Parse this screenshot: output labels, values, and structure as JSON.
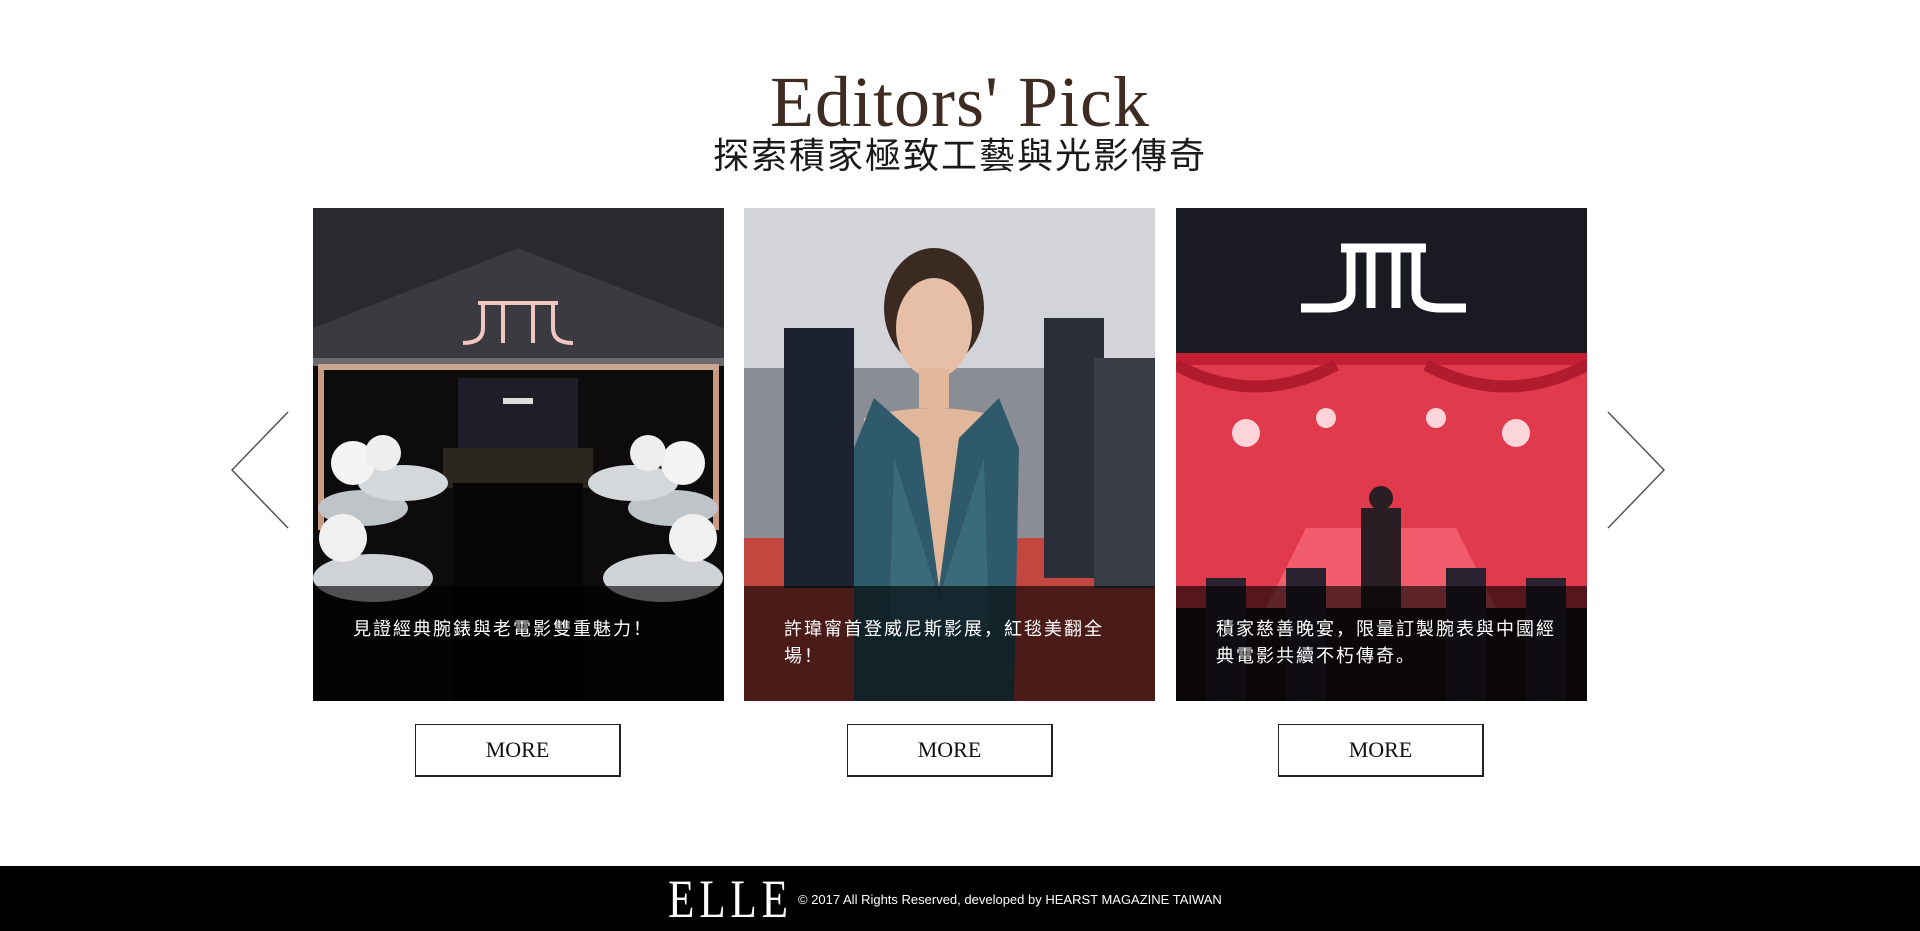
{
  "header": {
    "title": "Editors' Pick",
    "subtitle": "探索積家極致工藝與光影傳奇"
  },
  "carousel": {
    "prev_icon": "chevron-left-icon",
    "next_icon": "chevron-right-icon",
    "cards": [
      {
        "caption": "見證經典腕錶與老電影雙重魅力！",
        "more_label": "MORE"
      },
      {
        "caption": "許瑋甯首登威尼斯影展，紅毯美翻全場！",
        "more_label": "MORE"
      },
      {
        "caption": "積家慈善晚宴，限量訂製腕表與中國經典電影共續不朽傳奇。",
        "more_label": "MORE"
      }
    ]
  },
  "footer": {
    "logo_text": "ELLE",
    "copyright": "© 2017 All Rights Reserved, developed by HEARST MAGAZINE TAIWAN"
  },
  "colors": {
    "title": "#3e2c23",
    "footer_bg": "#000000",
    "caption_overlay": "rgba(0,0,0,0.62)"
  }
}
